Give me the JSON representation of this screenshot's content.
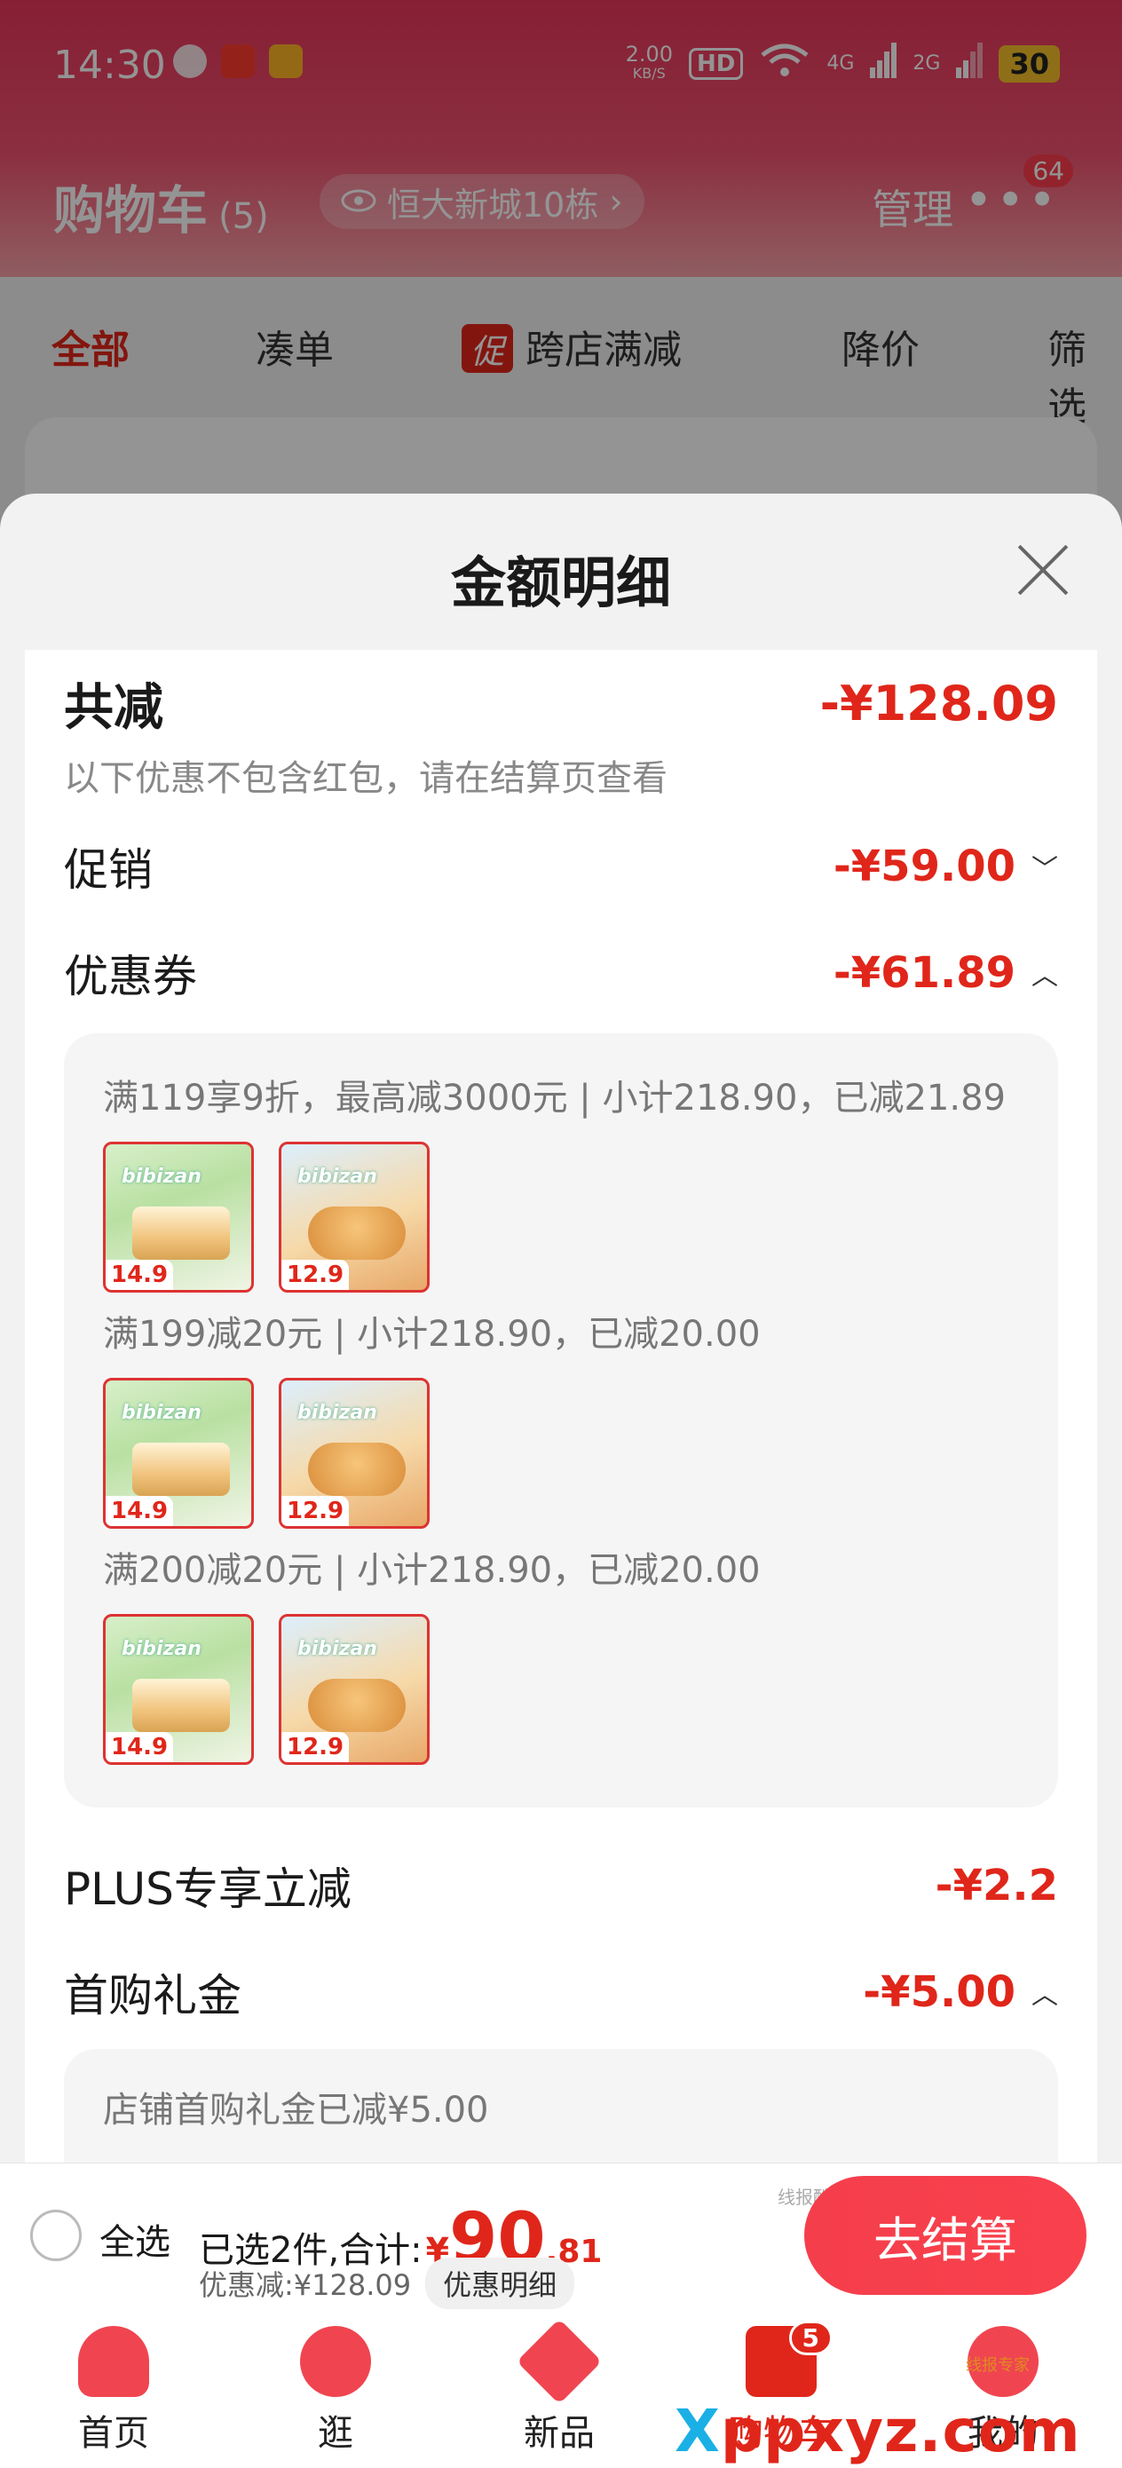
{
  "status_bar": {
    "time": "14:30",
    "net_speed": "2.00",
    "net_unit": "KB/S",
    "hd": "HD",
    "net_4g": "4G",
    "net_2g": "2G",
    "battery": "30"
  },
  "header": {
    "title": "购物车",
    "count": "(5)",
    "location": "恒大新城10栋",
    "manage": "管理",
    "more_badge": "64"
  },
  "filter_tabs": {
    "all": "全部",
    "combine": "凑单",
    "cross_shop_tag": "促",
    "cross_shop": "跨店满减",
    "price_drop": "降价",
    "filter": "筛选"
  },
  "sheet": {
    "title": "金额明细",
    "total_label": "共减",
    "total_value": "-¥128.09",
    "note": "以下优惠不包含红包，请在结算页查看",
    "promo_label": "促销",
    "promo_value": "-¥59.00",
    "coupon_label": "优惠券",
    "coupon_value": "-¥61.89",
    "coupon_rules": [
      {
        "text": "满119享9折，最高减3000元 | 小计218.90，已减21.89"
      },
      {
        "text": "满199减20元 | 小计218.90，已减20.00"
      },
      {
        "text": "满200减20元 | 小计218.90，已减20.00"
      }
    ],
    "product_a_price": "14.9",
    "product_b_price": "12.9",
    "product_brand": "bibizan",
    "plus_label": "PLUS专享立减",
    "plus_value": "-¥2.2",
    "first_gift_label": "首购礼金",
    "first_gift_value": "-¥5.00",
    "first_gift_note": "店铺首购礼金已减¥5.00"
  },
  "checkout": {
    "select_all": "全选",
    "selected_text": "已选2件,合计:",
    "currency": "¥",
    "amount_int": "90",
    "amount_dec": ".81",
    "discount_text": "优惠减:¥128.09",
    "detail_button": "优惠明细",
    "checkout_button": "去结算",
    "watermark": "线报酷-new.xianbao.fun"
  },
  "bottom_nav": {
    "home": "首页",
    "browse": "逛",
    "new": "新品",
    "cart": "购物车",
    "cart_badge": "5",
    "me": "我的"
  },
  "watermarks": {
    "big": "ppxyz.com",
    "big_prefix": "X",
    "tiny": "线报专家"
  },
  "colors": {
    "accent": "#e0261a",
    "header_gradient_top": "#e8365a",
    "checkout_button": "#f53e4b"
  }
}
